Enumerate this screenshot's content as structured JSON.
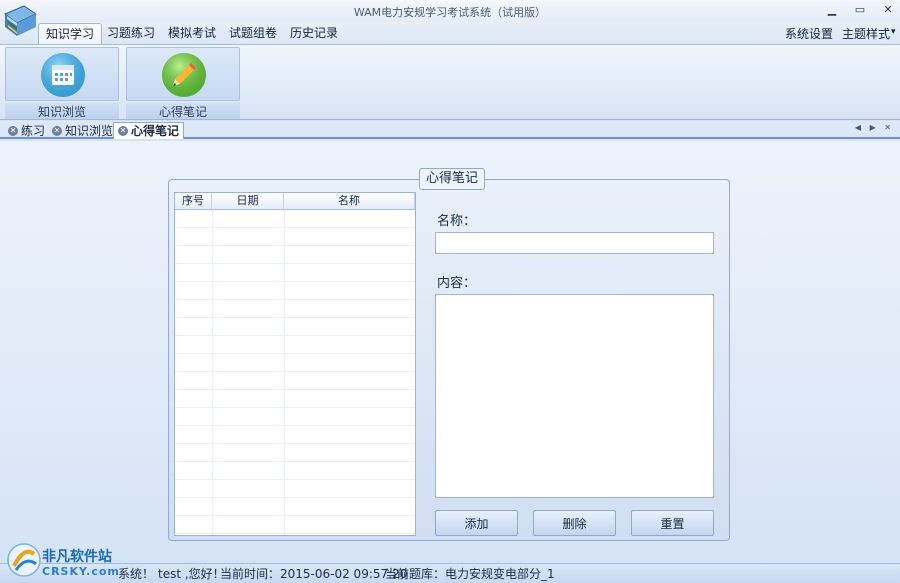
{
  "window": {
    "title": "WAM电力安规学习考试系统（试用版）"
  },
  "menu": {
    "tabs": [
      "知识学习",
      "习题练习",
      "模拟考试",
      "试题组卷",
      "历史记录"
    ],
    "right": [
      "系统设置",
      "主题样式"
    ],
    "dropdown_arrow": "▾"
  },
  "ribbon": {
    "buttons": [
      {
        "label": "知识浏览",
        "icon": "calendar-icon"
      },
      {
        "label": "心得笔记",
        "icon": "pencil-icon"
      }
    ]
  },
  "doc_tabs": [
    "练习",
    "知识浏览",
    "心得笔记"
  ],
  "panel": {
    "title": "心得笔记",
    "grid_headers": [
      "序号",
      "日期",
      "名称"
    ],
    "name_label": "名称：",
    "content_label": "内容：",
    "name_value": "",
    "content_value": "",
    "buttons": [
      "添加",
      "删除",
      "重置"
    ]
  },
  "status": {
    "welcome_tail": "系统！",
    "greeting": "test ,您好！",
    "time_label": "当前时间：2015-06-02 09:57:20",
    "bank_label": "当前题库：电力安规变电部分_1"
  },
  "watermark": {
    "name_cn": "非凡软件站",
    "name_en": "CRSKY.com"
  }
}
